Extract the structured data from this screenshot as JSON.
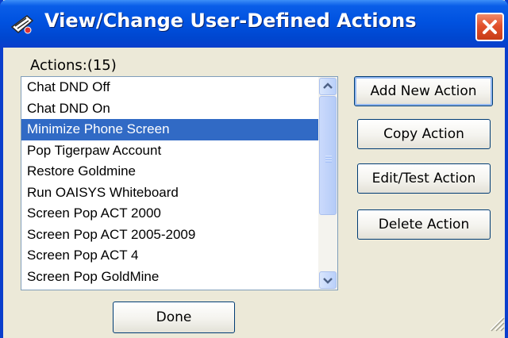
{
  "window": {
    "title": "View/Change User-Defined Actions",
    "title_bar_color": "#0a5ee8",
    "close_color": "#e2512c"
  },
  "actions": {
    "label": "Actions:(15)",
    "selected_index": 2,
    "items": [
      "Chat DND Off",
      "Chat DND On",
      "Minimize Phone Screen",
      "Pop Tigerpaw Account",
      "Restore Goldmine",
      "Run OAISYS Whiteboard",
      "Screen Pop ACT 2000",
      "Screen Pop ACT 2005-2009",
      "Screen Pop ACT 4",
      "Screen Pop GoldMine"
    ],
    "selection_color": "#316ac5"
  },
  "buttons": {
    "add": "Add New Action",
    "copy": "Copy Action",
    "edit": "Edit/Test Action",
    "delete": "Delete Action",
    "done": "Done"
  },
  "icons": {
    "app": "phone-app-icon",
    "close": "close-icon",
    "scroll_up": "chevron-up-icon",
    "scroll_down": "chevron-down-icon",
    "resize": "resize-grip-icon"
  }
}
